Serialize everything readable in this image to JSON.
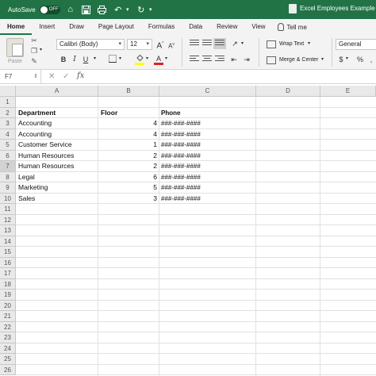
{
  "titlebar": {
    "autosave_label": "AutoSave",
    "autosave_state": "OFF",
    "document_title": "Excel Employees Example",
    "accent_color": "#217346"
  },
  "ribbon_tabs": [
    "Home",
    "Insert",
    "Draw",
    "Page Layout",
    "Formulas",
    "Data",
    "Review",
    "View"
  ],
  "tell_me": "Tell me",
  "ribbon": {
    "paste_label": "Paste",
    "font_name": "Calibri (Body)",
    "font_size": "12",
    "wrap_text_label": "Wrap Text",
    "merge_center_label": "Merge & Center",
    "number_format": "General",
    "bold": "B",
    "italic": "I",
    "underline": "U",
    "grow_font": "A",
    "shrink_font": "A",
    "font_color_letter": "A",
    "percent": "%"
  },
  "formula_bar": {
    "name_box": "F7",
    "fx_label": "fx",
    "content": ""
  },
  "sheet": {
    "columns": [
      "A",
      "B",
      "C",
      "D",
      "E"
    ],
    "row_numbers": [
      "1",
      "2",
      "3",
      "4",
      "5",
      "6",
      "7",
      "8",
      "9",
      "10",
      "11",
      "12",
      "13",
      "14",
      "15",
      "16",
      "17",
      "18",
      "19",
      "20",
      "21",
      "22",
      "23",
      "24",
      "25",
      "26"
    ],
    "selected_row": "7",
    "header_row": {
      "department": "Department",
      "floor": "Floor",
      "phone": "Phone"
    },
    "rows": [
      {
        "department": "Accounting",
        "floor": "4",
        "phone": "###-###-####"
      },
      {
        "department": "Accounting",
        "floor": "4",
        "phone": "###-###-####"
      },
      {
        "department": "Customer Service",
        "floor": "1",
        "phone": "###-###-####"
      },
      {
        "department": "Human Resources",
        "floor": "2",
        "phone": "###-###-####"
      },
      {
        "department": "Human Resources",
        "floor": "2",
        "phone": "###-###-####"
      },
      {
        "department": "Legal",
        "floor": "6",
        "phone": "###-###-####"
      },
      {
        "department": "Marketing",
        "floor": "5",
        "phone": "###-###-####"
      },
      {
        "department": "Sales",
        "floor": "3",
        "phone": "###-###-####"
      }
    ]
  }
}
